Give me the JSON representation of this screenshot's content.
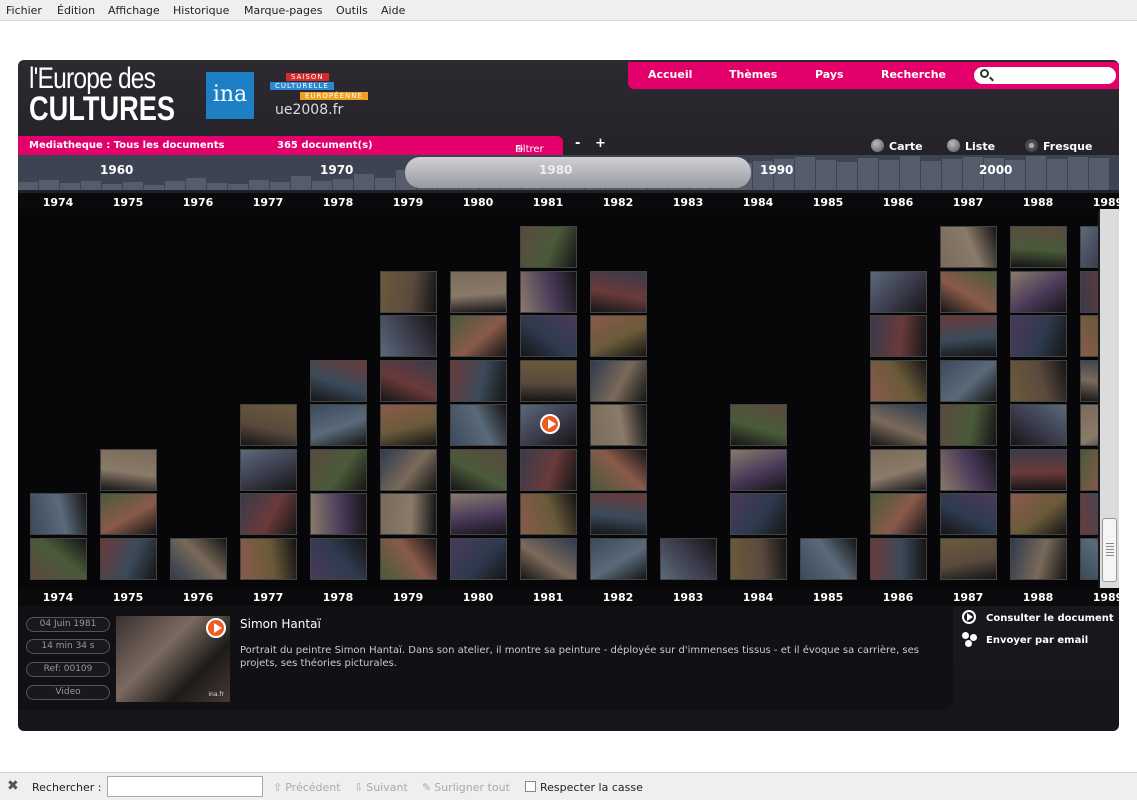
{
  "menubar": {
    "items": [
      "Fichier",
      "Édition",
      "Affichage",
      "Historique",
      "Marque-pages",
      "Outils",
      "Aide"
    ]
  },
  "header": {
    "logo_line1": "l'Europe des",
    "logo_line2": "CULTURES",
    "ina_logo": "ina",
    "ue_band1": "SAISON",
    "ue_band2": "CULTURELLE",
    "ue_band3": "EUROPÉENNE",
    "ue_text": "ue2008.fr"
  },
  "nav": {
    "items": [
      "Accueil",
      "Thèmes",
      "Pays",
      "Recherche"
    ],
    "search_placeholder": ""
  },
  "mediatheque": {
    "label": "Mediatheque : Tous les documents",
    "count": "365 document(s)",
    "filter": "Filtrer"
  },
  "zoom": {
    "minus": "-",
    "plus": "+"
  },
  "views": {
    "items": [
      "Carte",
      "Liste",
      "Fresque"
    ],
    "selected": "Fresque"
  },
  "timeline": {
    "decades": [
      "1960",
      "1970",
      "1980",
      "1990",
      "2000"
    ],
    "years": [
      "1974",
      "1975",
      "1976",
      "1977",
      "1978",
      "1979",
      "1980",
      "1981",
      "1982",
      "1983",
      "1984",
      "1985",
      "1986",
      "1987",
      "1988",
      "1989"
    ],
    "column_counts": [
      2,
      3,
      1,
      4,
      5,
      7,
      7,
      8,
      7,
      1,
      4,
      1,
      7,
      8,
      8,
      8
    ]
  },
  "detail": {
    "date": "04 Juin 1981",
    "duration": "14 min 34 s",
    "ref": "Ref: 00109",
    "type": "Video",
    "title": "Simon Hantaï",
    "description": "Portrait du peintre Simon Hantaï. Dans son atelier, il montre sa peinture - déployée sur d'immenses tissus - et il évoque sa carrière, ses projets, ses théories picturales.",
    "thumb_label": "ina.fr"
  },
  "actions": {
    "consult": "Consulter le document",
    "email": "Envoyer par email"
  },
  "findbar": {
    "label": "Rechercher :",
    "value": "",
    "prev": "Précédent",
    "next": "Suivant",
    "highlight": "Surligner tout",
    "match_case": "Respecter la casse"
  }
}
